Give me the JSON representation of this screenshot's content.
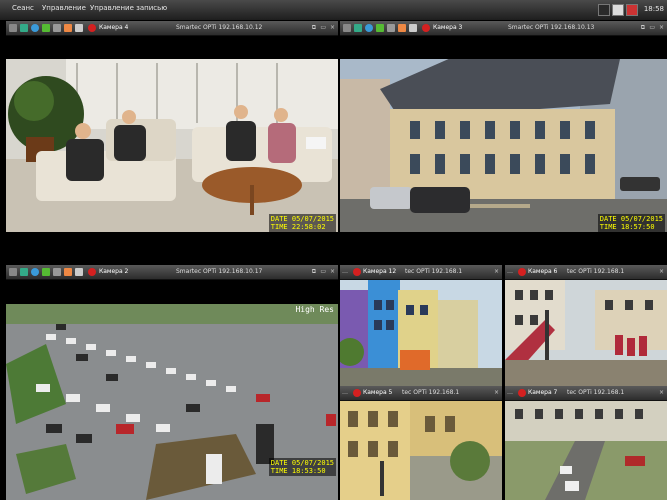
{
  "menu": {
    "items": [
      "Сеанс",
      "Управление",
      "Управление записью"
    ],
    "clock": "18:58"
  },
  "cameras": [
    {
      "name": "Камера 4",
      "ip": "Smartec OPTi 192.168.10.12",
      "osd_date": "DATE 05/07/2015",
      "osd_time": "TIME 22:58:02"
    },
    {
      "name": "Камера 3",
      "ip": "Smartec OPTi 192.168.10.13",
      "osd_date": "DATE 05/07/2015",
      "osd_time": "TIME 18:57:50"
    },
    {
      "name": "Камера 2",
      "ip": "Smartec OPTi 192.168.10.17",
      "osd_date": "DATE 05/07/2015",
      "osd_time": "TIME 18:53:50",
      "osd_overlay": "High Res"
    },
    {
      "name": "Камера 12",
      "ip": "tec OPTi 192.168.1"
    },
    {
      "name": "Камера 6",
      "ip": "tec OPTi 192.168.1"
    },
    {
      "name": "Камера 5",
      "ip": "tec OPTi 192.168.1"
    },
    {
      "name": "Камера 7",
      "ip": "tec OPTi 192.168.1"
    }
  ],
  "colors": {
    "titlebar": "#3a3a3a",
    "osd": "#ffff00",
    "record_icon": "#d42020"
  },
  "icons": [
    "menu-icon",
    "camera-icon",
    "globe-icon",
    "person-icon",
    "settings-icon",
    "mic-icon",
    "record-icon"
  ]
}
